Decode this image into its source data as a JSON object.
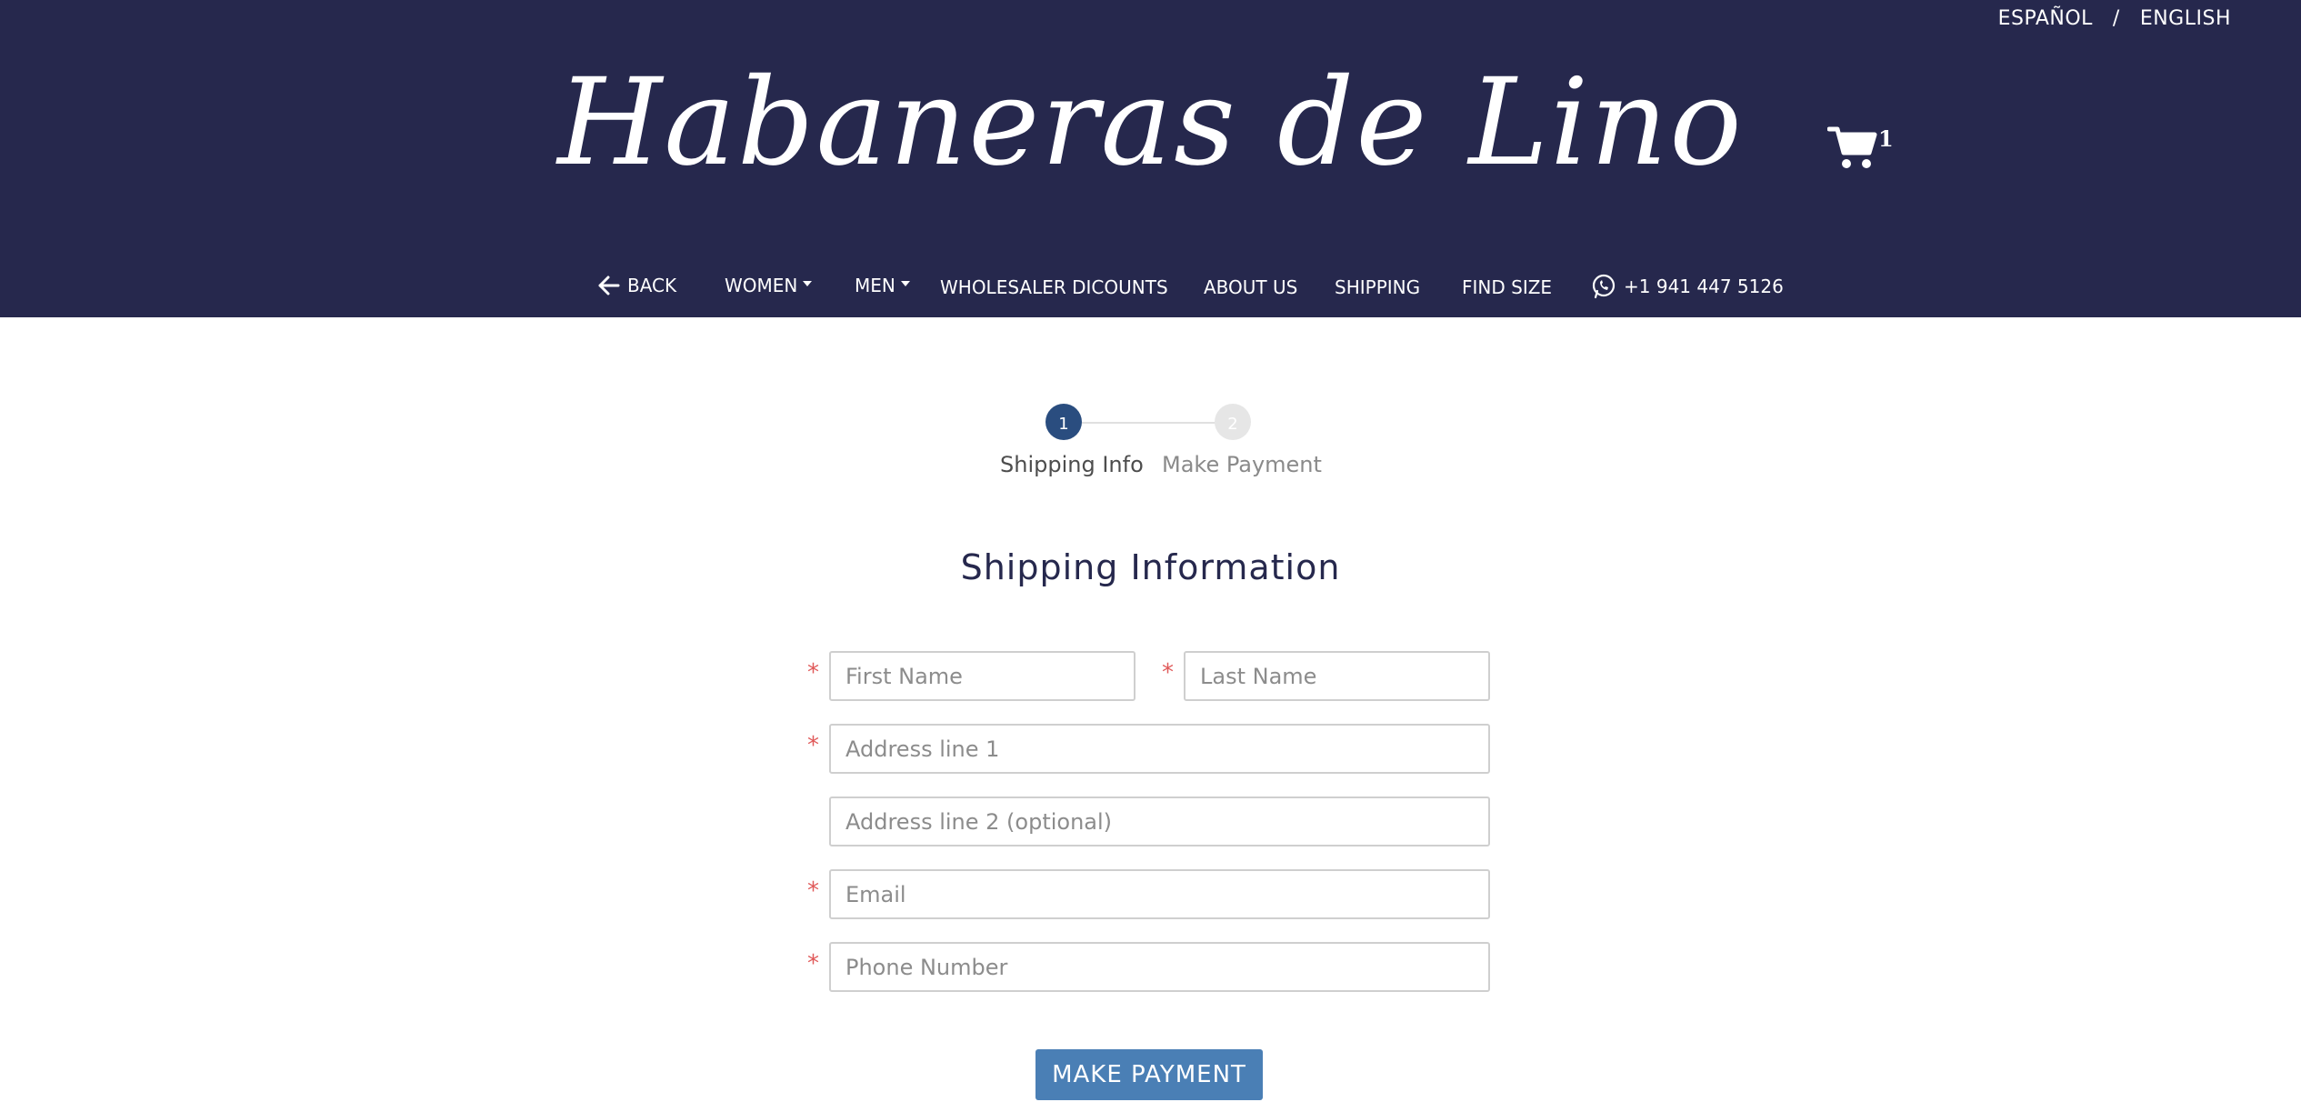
{
  "header": {
    "logo_text": "Habaneras de Lino",
    "languages": [
      "ESPAÑOL",
      "ENGLISH"
    ],
    "lang_separator": "/",
    "cart_icon": "shopping-cart-icon",
    "cart_count": "1",
    "background_color": "#26284d"
  },
  "nav": {
    "back": "BACK",
    "women": "WOMEN",
    "men": "MEN",
    "wholesaler": "WHOLESALER DICOUNTS",
    "about": "ABOUT US",
    "shipping": "SHIPPING",
    "find_size": "FIND SIZE",
    "phone": "+1 941 447 5126",
    "phone_icon": "whatsapp-icon",
    "back_icon": "arrow-left-icon"
  },
  "stepper": {
    "steps": [
      {
        "number": "1",
        "label": "Shipping Info",
        "active": true
      },
      {
        "number": "2",
        "label": "Make Payment",
        "active": false
      }
    ],
    "active_color": "#2a4d7f"
  },
  "form": {
    "title": "Shipping Information",
    "required_mark": "*",
    "fields": {
      "first_name": {
        "placeholder": "First Name",
        "value": "",
        "required": true
      },
      "last_name": {
        "placeholder": "Last Name",
        "value": "",
        "required": true
      },
      "address1": {
        "placeholder": "Address line 1",
        "value": "",
        "required": true
      },
      "address2": {
        "placeholder": "Address line 2 (optional)",
        "value": "",
        "required": false
      },
      "email": {
        "placeholder": "Email",
        "value": "",
        "required": true
      },
      "phone": {
        "placeholder": "Phone Number",
        "value": "",
        "required": true
      }
    },
    "submit_label": "MAKE PAYMENT",
    "submit_color": "#4a7fb5"
  }
}
